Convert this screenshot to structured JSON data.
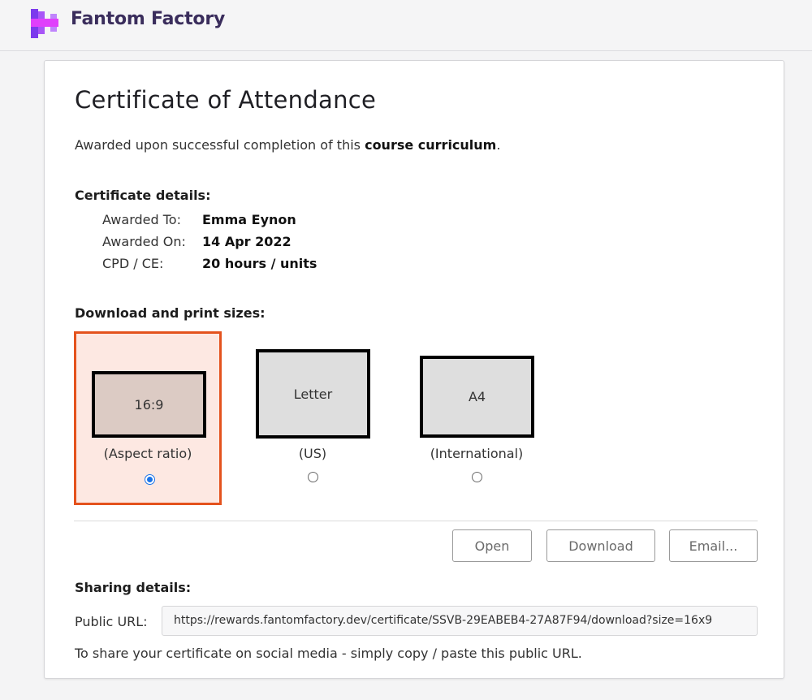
{
  "header": {
    "brand": "Fantom Factory",
    "logo_icon": "fantom-factory-logo-icon",
    "logo_colors": [
      "#7c3aed",
      "#e040fb",
      "#a855f7"
    ]
  },
  "certificate": {
    "title": "Certificate of Attendance",
    "subtitle_prefix": "Awarded upon successful completion of this ",
    "subtitle_bold": "course curriculum",
    "subtitle_suffix": "."
  },
  "details": {
    "heading": "Certificate details:",
    "rows": [
      {
        "label": "Awarded To:",
        "value": "Emma Eynon"
      },
      {
        "label": "Awarded On:",
        "value": "14 Apr 2022"
      },
      {
        "label": "CPD / CE:",
        "value": "20 hours / units"
      }
    ]
  },
  "sizes": {
    "heading": "Download and print sizes:",
    "selected": "16:9",
    "options": [
      {
        "label": "16:9",
        "caption": "(Aspect ratio)",
        "checked": true
      },
      {
        "label": "Letter",
        "caption": "(US)",
        "checked": false
      },
      {
        "label": "A4",
        "caption": "(International)",
        "checked": false
      }
    ],
    "selected_border_color": "#e4521d",
    "selected_bg_color": "#fde8e2"
  },
  "actions": {
    "open_label": "Open",
    "download_label": "Download",
    "email_label": "Email..."
  },
  "sharing": {
    "heading": "Sharing details:",
    "url_label": "Public URL:",
    "url_value": "https://rewards.fantomfactory.dev/certificate/SSVB-29EABEB4-27A87F94/download?size=16x9",
    "note": "To share your certificate on social media - simply copy / paste this public URL."
  }
}
